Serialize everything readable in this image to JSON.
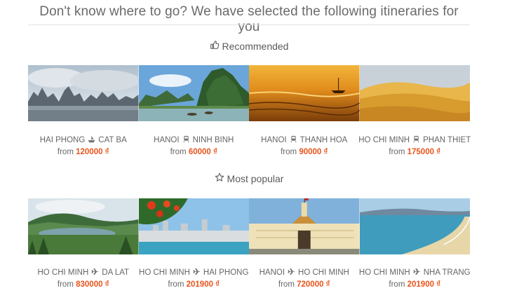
{
  "headline": "Don't know where to go? We have selected the following itineraries for you",
  "sections": {
    "recommended": {
      "title": "Recommended",
      "icon": "thumbs-up-icon",
      "items": [
        {
          "from": "HAI PHONG",
          "to": "CAT BA",
          "icon": "boat-icon",
          "prefix": "from",
          "price": "120000 ₫"
        },
        {
          "from": "HANOI",
          "to": "NINH BINH",
          "icon": "train-icon",
          "prefix": "from",
          "price": "60000 ₫"
        },
        {
          "from": "HANOI",
          "to": "THANH HOA",
          "icon": "train-icon",
          "prefix": "from",
          "price": "90000 ₫"
        },
        {
          "from": "HO CHI MINH",
          "to": "PHAN THIET",
          "icon": "train-icon",
          "prefix": "from",
          "price": "175000 ₫"
        }
      ]
    },
    "popular": {
      "title": "Most popular",
      "icon": "star-icon",
      "items": [
        {
          "from": "HO CHI MINH",
          "to": "DA LAT",
          "icon": "plane-icon",
          "prefix": "from",
          "price": "830000 ₫"
        },
        {
          "from": "HO CHI MINH",
          "to": "HAI PHONG",
          "icon": "plane-icon",
          "prefix": "from",
          "price": "201900 ₫"
        },
        {
          "from": "HANOI",
          "to": "HO CHI MINH",
          "icon": "plane-icon",
          "prefix": "from",
          "price": "720000 ₫"
        },
        {
          "from": "HO CHI MINH",
          "to": "NHA TRANG",
          "icon": "plane-icon",
          "prefix": "from",
          "price": "201900 ₫"
        }
      ]
    }
  },
  "colors": {
    "price": "#e8541b",
    "text": "#666666",
    "rule": "#e2e2e2"
  }
}
